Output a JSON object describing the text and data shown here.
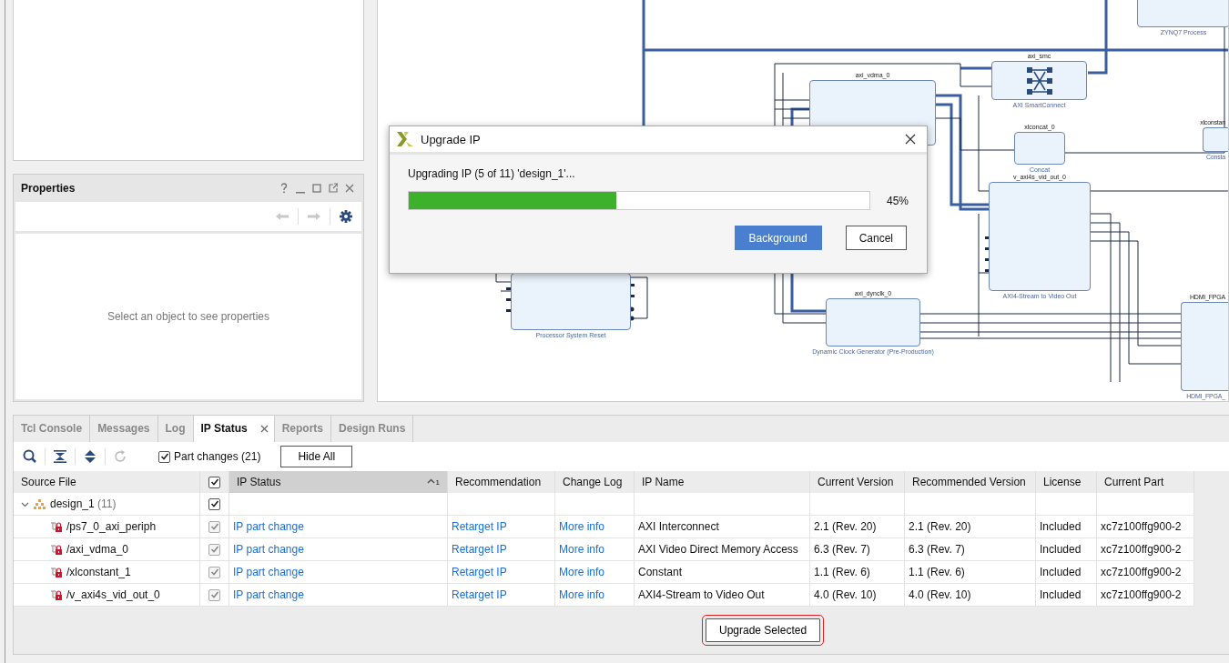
{
  "properties": {
    "title": "Properties",
    "empty_message": "Select an object to see properties"
  },
  "diagram": {
    "blocks": [
      {
        "label": "ZYNQ7 Process"
      },
      {
        "title": "axi_vdma_0",
        "kind": "plain"
      },
      {
        "title": "axi_smc",
        "label": "AXI SmartConnect",
        "kind": "crossbar"
      },
      {
        "title": "xlconcat_0",
        "label": "Concat",
        "kind": "plain"
      },
      {
        "title": "xlconstan",
        "label": "Consta",
        "kind": "plain"
      },
      {
        "title": "v_axi4s_vid_out_0",
        "label": "AXI4-Stream to Video Out",
        "kind": "plain"
      },
      {
        "label": "Processor System Reset",
        "kind": "plain"
      },
      {
        "title": "axi_dynclk_0",
        "label": "Dynamic Clock Generator (Pre-Production)",
        "kind": "plain"
      },
      {
        "title": "HDMI_FPGA",
        "label": "HDMI_FPGA_",
        "kind": "plain"
      }
    ]
  },
  "bottom_panel": {
    "tabs": [
      {
        "label": "Tcl Console",
        "selected": false
      },
      {
        "label": "Messages",
        "selected": false
      },
      {
        "label": "Log",
        "selected": false
      },
      {
        "label": "IP Status",
        "selected": true
      },
      {
        "label": "Reports",
        "selected": false
      },
      {
        "label": "Design Runs",
        "selected": false
      }
    ],
    "filter": {
      "label": "Part changes (21)",
      "checked": true
    },
    "hide_button": "Hide All",
    "table": {
      "columns": [
        {
          "label": "Source File"
        },
        {
          "kind": "check",
          "checked": true
        },
        {
          "label": "IP Status",
          "sort_rank": "1"
        },
        {
          "label": "Recommendation"
        },
        {
          "label": "Change Log"
        },
        {
          "label": "IP Name"
        },
        {
          "label": "Current Version"
        },
        {
          "label": "Recommended Version"
        },
        {
          "label": "License"
        },
        {
          "label": "Current Part"
        }
      ],
      "groups": [
        {
          "name": "design_1",
          "count": "(11)",
          "expanded": true,
          "checked": true,
          "rows": [
            {
              "source": "/ps7_0_axi_periph",
              "checked": true,
              "disabled": true,
              "ip_status": "IP part change",
              "recommendation": "Retarget IP",
              "change_log": "More info",
              "ip_name": "AXI Interconnect",
              "current_version": "2.1 (Rev. 20)",
              "recommended_version": "2.1 (Rev. 20)",
              "license": "Included",
              "current_part": "xc7z100ffg900-2"
            },
            {
              "source": "/axi_vdma_0",
              "checked": true,
              "disabled": true,
              "ip_status": "IP part change",
              "recommendation": "Retarget IP",
              "change_log": "More info",
              "ip_name": "AXI Video Direct Memory Access",
              "current_version": "6.3 (Rev. 7)",
              "recommended_version": "6.3 (Rev. 7)",
              "license": "Included",
              "current_part": "xc7z100ffg900-2"
            },
            {
              "source": "/xlconstant_1",
              "checked": true,
              "disabled": true,
              "ip_status": "IP part change",
              "recommendation": "Retarget IP",
              "change_log": "More info",
              "ip_name": "Constant",
              "current_version": "1.1 (Rev. 6)",
              "recommended_version": "1.1 (Rev. 6)",
              "license": "Included",
              "current_part": "xc7z100ffg900-2"
            },
            {
              "source": "/v_axi4s_vid_out_0",
              "checked": true,
              "disabled": true,
              "ip_status": "IP part change",
              "recommendation": "Retarget IP",
              "change_log": "More info",
              "ip_name": "AXI4-Stream to Video Out",
              "current_version": "4.0 (Rev. 10)",
              "recommended_version": "4.0 (Rev. 10)",
              "license": "Included",
              "current_part": "xc7z100ffg900-2"
            }
          ]
        }
      ]
    },
    "upgrade_button": {
      "label": "Upgrade Selected",
      "highlighted": true
    }
  },
  "dialog": {
    "title": "Upgrade IP",
    "message": "Upgrading IP (5 of 11) 'design_1'...",
    "progress": {
      "level": 0.45,
      "reading": "45%"
    },
    "buttons": [
      {
        "label": "Background",
        "default": true
      },
      {
        "label": "Cancel",
        "default": false
      }
    ]
  }
}
